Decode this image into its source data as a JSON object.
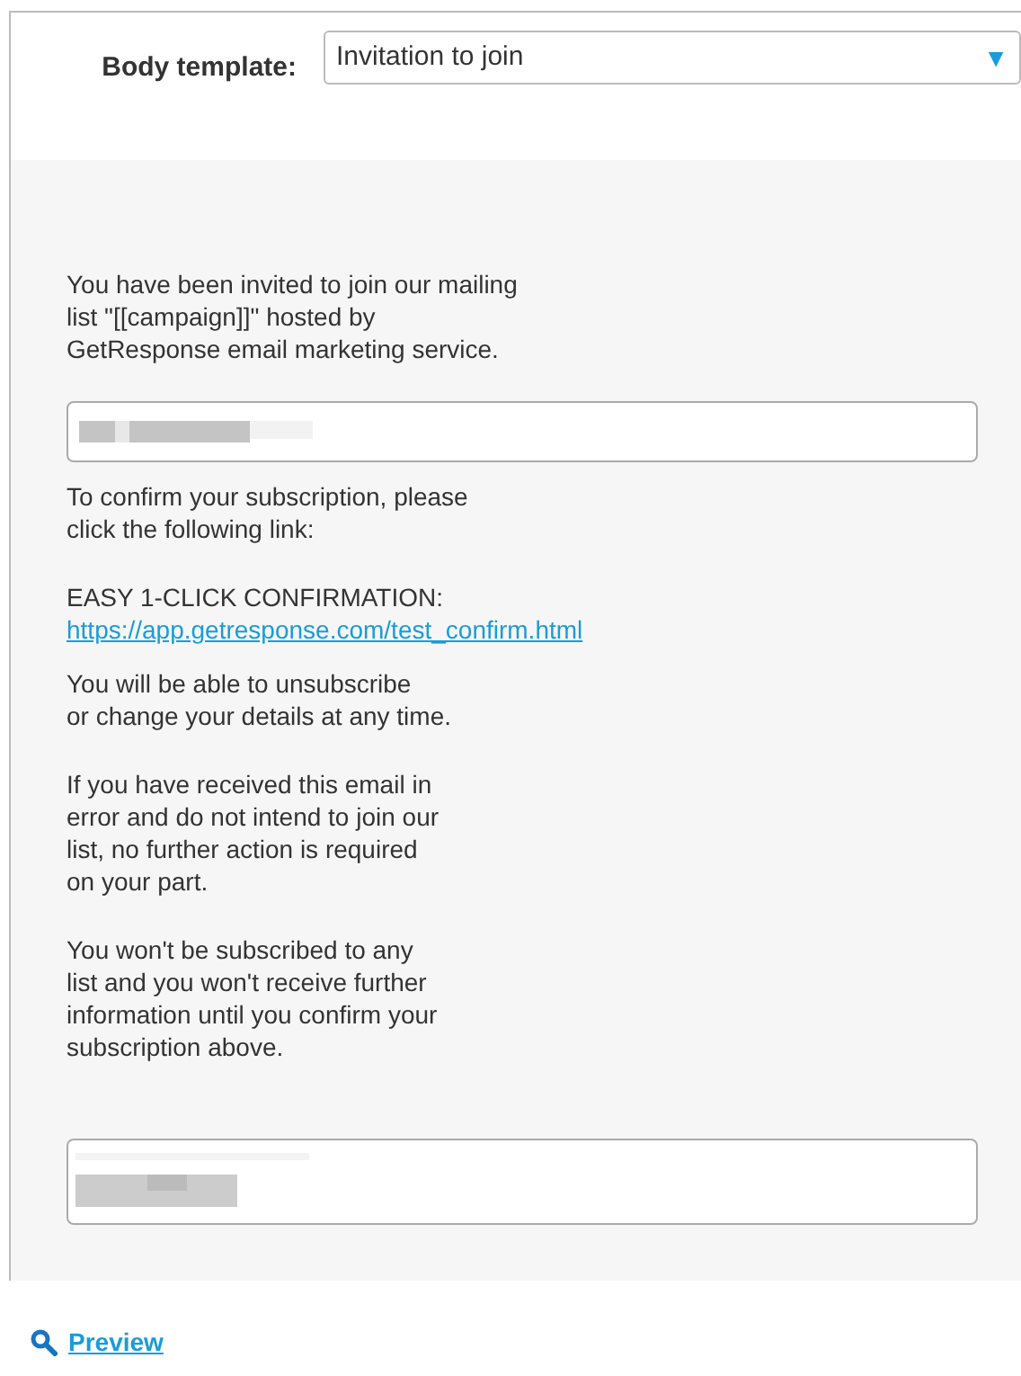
{
  "body_template": {
    "label": "Body template:",
    "value": "Invitation to join",
    "arrow": "▼"
  },
  "email_body": [
    {
      "kind": "text",
      "text": "You have been invited to join our mailing\nlist \"[[campaign]]\" hosted by\nGetResponse email marketing service."
    },
    {
      "kind": "field"
    },
    {
      "kind": "text",
      "text": "To confirm your subscription, please\nclick the following link:"
    },
    {
      "kind": "link",
      "text": "EASY 1-CLICK CONFIRMATION:",
      "link": "https://app.getresponse.com/test_confirm.html"
    },
    {
      "kind": "text",
      "text": "You will be able to unsubscribe\nor change your details at any time."
    },
    {
      "kind": "text",
      "text": "If you have received this email in\nerror and do not intend to join our\nlist, no further action is required\non your part."
    },
    {
      "kind": "text",
      "text": "You won't be subscribed to any\nlist and you won't receive further\ninformation until you confirm your\nsubscription above."
    },
    {
      "kind": "field"
    }
  ],
  "preview_link": "Preview"
}
